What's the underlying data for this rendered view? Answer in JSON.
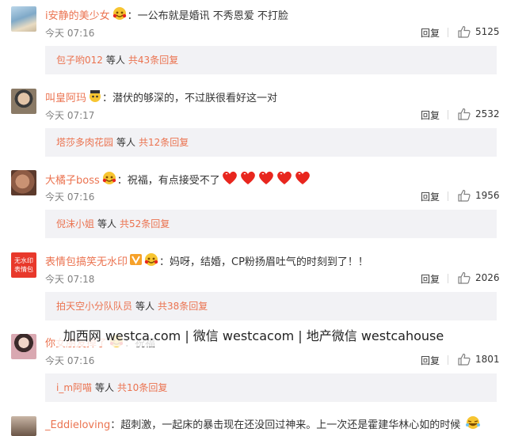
{
  "colors": {
    "username": "#eb7350",
    "link": "#eb7350",
    "subreply_bg": "#f2f2f5",
    "time": "#808080",
    "heart": "#e8261e"
  },
  "watermark": "加西网 westca.com | 微信 westcacom | 地产微信 westcahouse",
  "comments": [
    {
      "username": "i安静的美少女",
      "text": "：一公布就是婚讯 不秀恩爱 不打脸",
      "time": "今天 07:16",
      "reply": "回复",
      "likes": "5125",
      "sub_name": "包子哟012",
      "sub_mid": "等人",
      "sub_count": "共43条回复",
      "avatar_icon": "beach-photo-icon",
      "badge_icon": "smile-badge-icon"
    },
    {
      "username": "叫皇阿玛",
      "text": "：潜伏的够深的，不过朕很看好这一对",
      "time": "今天 07:17",
      "reply": "回复",
      "likes": "2532",
      "sub_name": "塔莎多肉花园",
      "sub_mid": "等人",
      "sub_count": "共12条回复",
      "avatar_icon": "emperor-portrait-icon",
      "badge_icon": "crown-badge-icon"
    },
    {
      "username": "大橘子boss",
      "text": "：祝福，有点接受不了",
      "time": "今天 07:16",
      "reply": "回复",
      "likes": "1956",
      "sub_name": "倪沫小姐",
      "sub_mid": "等人",
      "sub_count": "共52条回复",
      "avatar_icon": "person-photo-icon",
      "badge_icon": "smile-badge-icon"
    },
    {
      "username": "表情包搞笑无水印",
      "text": "：妈呀，结婚，CP粉扬眉吐气的时刻到了！！",
      "time": "今天 07:18",
      "reply": "回复",
      "likes": "2026",
      "sub_name": "拍天空小分队队员",
      "sub_mid": "等人",
      "sub_count": "共38条回复",
      "avatar_icon": "red-text-logo-icon",
      "badge_icon": "vip-badge-icon",
      "avatar_text": "无水印\n表情包"
    },
    {
      "username": "你女朋友掉了",
      "text": "：祝福",
      "time": "今天 07:16",
      "reply": "回复",
      "likes": "1801",
      "sub_name": "i_m阿喵",
      "sub_mid": "等人",
      "sub_count": "共10条回复",
      "avatar_icon": "girl-photo-icon",
      "badge_icon": "smile-badge-icon"
    }
  ],
  "last_comment": {
    "username": "_Eddieloving",
    "text": "：超刺激，一起床的暴击现在还没回过神来。上一次还是霍建华林心如的时候"
  }
}
